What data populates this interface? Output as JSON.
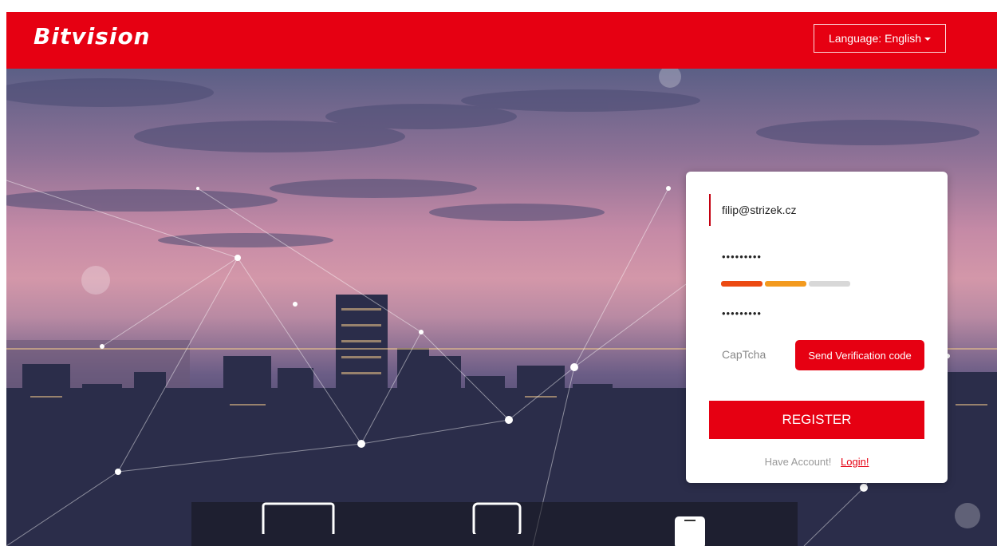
{
  "header": {
    "logo_text": "Bitvision",
    "language_label": "Language:",
    "language_value": "English",
    "brand_color": "#e60012"
  },
  "register_form": {
    "email_value": "filip@strizek.cz",
    "password_masked": "•••••••••",
    "confirm_password_masked": "•••••••••",
    "password_strength": {
      "segments_filled": 2,
      "segments_total": 3,
      "colors": [
        "#ec4a12",
        "#f39a1e",
        "#d8d8d8"
      ]
    },
    "captcha_placeholder": "CapTcha",
    "send_code_label": "Send Verification code",
    "register_label": "REGISTER",
    "have_account_text": "Have Account!",
    "login_link_text": "Login!"
  },
  "device_bar": {
    "icons": [
      "monitor-icon",
      "tablet-icon",
      "phone-icon"
    ]
  }
}
